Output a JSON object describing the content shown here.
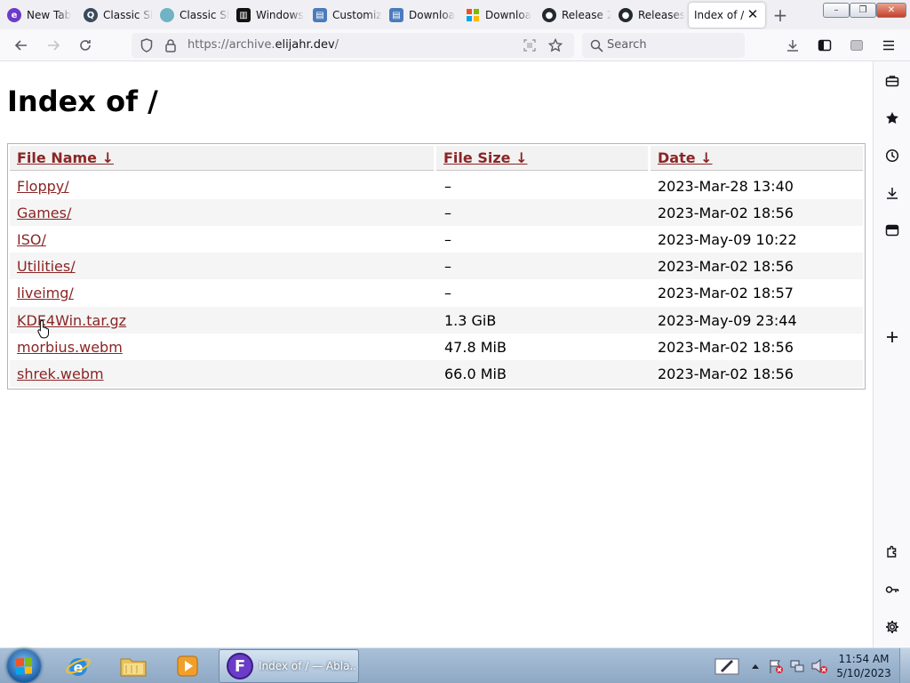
{
  "browser": {
    "tabs": [
      {
        "title": "New Tab",
        "icon": "firefox-icon",
        "color": "#6a3cc7"
      },
      {
        "title": "Classic Sh",
        "icon": "classic-shell-icon",
        "color": "#3a4a5c"
      },
      {
        "title": "Classic Sh",
        "icon": "classic-shell-shell-icon",
        "color": "#6fb3c5"
      },
      {
        "title": "Windows",
        "icon": "library-icon",
        "color": "#111111"
      },
      {
        "title": "Customiz",
        "icon": "customize-icon",
        "color": "#4a7bbd"
      },
      {
        "title": "Downloa",
        "icon": "download-page-icon",
        "color": "#4a7bbd"
      },
      {
        "title": "Downloa",
        "icon": "windows-logo-icon",
        "color": "#f25022"
      },
      {
        "title": "Release 2",
        "icon": "github-icon",
        "color": "#24292f"
      },
      {
        "title": "Releases",
        "icon": "github-icon",
        "color": "#24292f"
      },
      {
        "title": "Index of /",
        "icon": "",
        "color": ""
      }
    ],
    "new_tab_symbol": "+",
    "close_symbol": "✕",
    "window_controls": {
      "minimize": "–",
      "maximize": "❐",
      "close": "✕"
    },
    "url_prefix": "https://archive.",
    "url_host": "elijahr.dev",
    "url_suffix": "/",
    "search_placeholder": "Search",
    "accent_link_color": "#8b2525"
  },
  "page": {
    "title": "Index of /",
    "columns": {
      "name": "File Name  ↓",
      "size": "File Size  ↓",
      "date": "Date  ↓"
    },
    "rows": [
      {
        "name": "Floppy/",
        "size": "–",
        "date": "2023-Mar-28 13:40"
      },
      {
        "name": "Games/",
        "size": "–",
        "date": "2023-Mar-02 18:56"
      },
      {
        "name": "ISO/",
        "size": "–",
        "date": "2023-May-09 10:22"
      },
      {
        "name": "Utilities/",
        "size": "–",
        "date": "2023-Mar-02 18:56"
      },
      {
        "name": "liveimg/",
        "size": "–",
        "date": "2023-Mar-02 18:57"
      },
      {
        "name": "KDE4Win.tar.gz",
        "size": "1.3 GiB",
        "date": "2023-May-09 23:44"
      },
      {
        "name": "morbius.webm",
        "size": "47.8 MiB",
        "date": "2023-Mar-02 18:56"
      },
      {
        "name": "shrek.webm",
        "size": "66.0 MiB",
        "date": "2023-Mar-02 18:56"
      }
    ]
  },
  "sidebar": {
    "items": [
      "briefcase-icon",
      "star-icon",
      "history-clock-icon",
      "downloads-icon",
      "sidebar-panel-icon",
      "add-icon"
    ],
    "bottom_items": [
      "extensions-puzzle-icon",
      "key-icon",
      "settings-gear-icon"
    ]
  },
  "taskbar": {
    "pinned": [
      "internet-explorer-icon",
      "file-explorer-icon",
      "media-player-icon"
    ],
    "active_task": "Index of / — Abla...",
    "tray": [
      "pen-input-icon",
      "show-hidden-icons",
      "action-center-flag-icon",
      "network-icon",
      "volume-muted-icon"
    ],
    "time": "11:54 AM",
    "date": "5/10/2023"
  }
}
